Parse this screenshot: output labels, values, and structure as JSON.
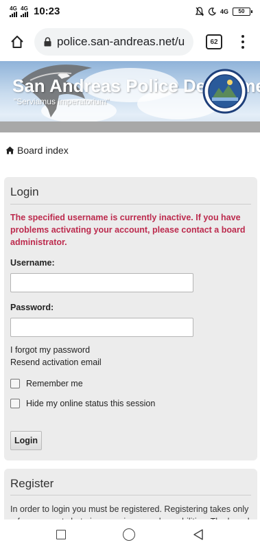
{
  "status_bar": {
    "network_1": "4G",
    "network_2": "4G",
    "time": "10:23",
    "network_right": "4G",
    "battery": "50"
  },
  "browser": {
    "url": "police.san-andreas.net/u",
    "tab_count": "62"
  },
  "header": {
    "title": "San Andreas Police Department",
    "motto": "\"Serviamus Imperatorium\""
  },
  "breadcrumb": {
    "label": "Board index"
  },
  "login": {
    "title": "Login",
    "error": "The specified username is currently inactive. If you have problems activating your account, please contact a board administrator.",
    "username_label": "Username:",
    "username_value": "",
    "password_label": "Password:",
    "password_value": "",
    "forgot_password": "I forgot my password",
    "resend_activation": "Resend activation email",
    "remember_me": "Remember me",
    "hide_status": "Hide my online status this session",
    "submit": "Login"
  },
  "register": {
    "title": "Register",
    "text": "In order to login you must be registered. Registering takes only a few moments but gives you increased capabilities. The board"
  },
  "colors": {
    "error": "#bc2a4d",
    "panel_bg": "#ececec",
    "header_sky": "#c8dbee"
  }
}
